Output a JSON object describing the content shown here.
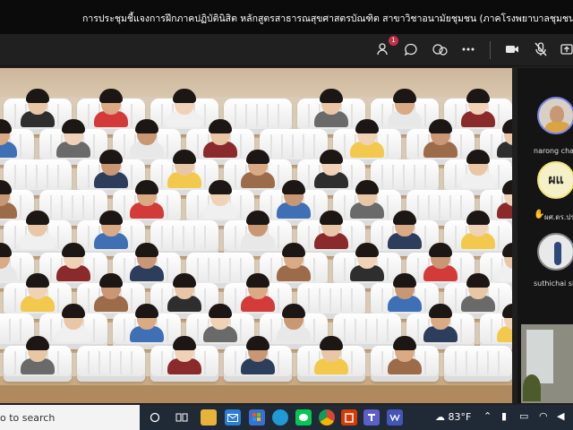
{
  "window": {
    "title": "การประชุมชี้แจงการฝึกภาคปฏิบัตินิสิต หลักสูตรสาธารณสุขศาสตรบัณฑิต สาขาวิชาอนามัยชุมชน (ภาคโรงพยาบาลชุมชน)"
  },
  "toolbar": {
    "people_badge": "1",
    "icons": [
      "people-icon",
      "chat-icon",
      "react-icon",
      "more-icon",
      "camera-icon",
      "mic-off-icon",
      "share-icon"
    ]
  },
  "participants": [
    {
      "name": "narong chail"
    },
    {
      "initials": "ผแ",
      "name": "ผศ.ดร.ปร"
    },
    {
      "name": "suthichai sir"
    }
  ],
  "taskbar": {
    "search_text": "o to search",
    "weather_temp": "83°F",
    "icons": [
      "circle-icon",
      "task-view-icon",
      "file-explorer-icon",
      "mail-icon",
      "store-icon",
      "edge-icon",
      "line-icon",
      "chrome-icon",
      "office-icon",
      "teams-icon",
      "app-icon"
    ],
    "colors": {
      "teams_badge": "#c4314b",
      "accent": "#7b83eb"
    }
  }
}
